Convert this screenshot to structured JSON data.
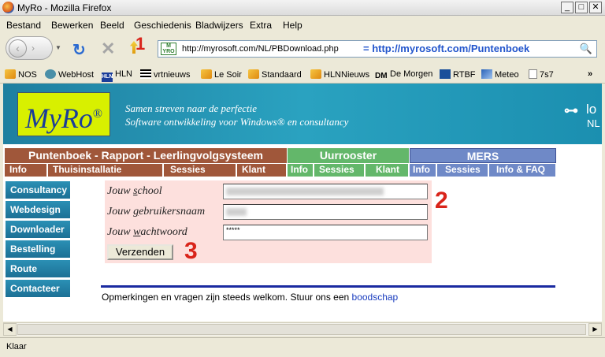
{
  "window": {
    "title": "MyRo - Mozilla Firefox",
    "controls": [
      "_",
      "□",
      "✕"
    ]
  },
  "menu": {
    "items": [
      "Bestand",
      "Bewerken",
      "Beeld",
      "Geschiedenis",
      "Bladwijzers",
      "Extra",
      "Help"
    ]
  },
  "nav": {
    "back": "‹",
    "forward": "›",
    "reload": "↻",
    "stop": "✕",
    "step1": "1"
  },
  "address": {
    "site_icon": "M YRO",
    "url": "http://myrosoft.com/NL/PBDownload.php",
    "note": "= http://myrosoft.com/Puntenboek",
    "search_icon": "🔍"
  },
  "bookmarks": {
    "items": [
      "NOS",
      "WebHost",
      "HLN",
      "vrtnieuws",
      "Le Soir",
      "Standaard",
      "HLNNieuws",
      "De Morgen",
      "RTBF",
      "Meteo",
      "7s7"
    ],
    "more": "»"
  },
  "banner": {
    "logo": "MyRo",
    "logo_mark": "®",
    "tagline1": "Samen streven naar de perfectie",
    "tagline2": "Software ontwikkeling voor Windows® en consultancy",
    "login_partial": "lo",
    "lang": "NL"
  },
  "tabs": {
    "puntenboek": {
      "title": "Puntenboek - Rapport - Leerlingvolgsysteem",
      "subs": [
        "Info",
        "Thuisinstallatie",
        "Sessies",
        "Klant"
      ]
    },
    "uurrooster": {
      "title": "Uurrooster",
      "subs": [
        "Info",
        "Sessies",
        "Klant"
      ]
    },
    "mers": {
      "title": "MERS",
      "subs": [
        "Info",
        "Sessies",
        "Info & FAQ"
      ]
    }
  },
  "sidebar": {
    "items": [
      "Consultancy",
      "Webdesign",
      "Downloader",
      "Bestelling",
      "Route",
      "Contacteer"
    ]
  },
  "form": {
    "school_label": "Jouw school",
    "school_label_u": "s",
    "user_label": "Jouw gebruikersnaam",
    "user_label_u": "g",
    "pass_label": "Jouw wachtwoord",
    "pass_label_u": "w",
    "pass_value": "*****",
    "submit": "Verzenden",
    "step2": "2",
    "step3": "3"
  },
  "footer": {
    "text": "Opmerkingen en vragen zijn steeds welkom. Stuur ons een ",
    "link": "boodschap"
  },
  "status": {
    "text": "Klaar"
  }
}
